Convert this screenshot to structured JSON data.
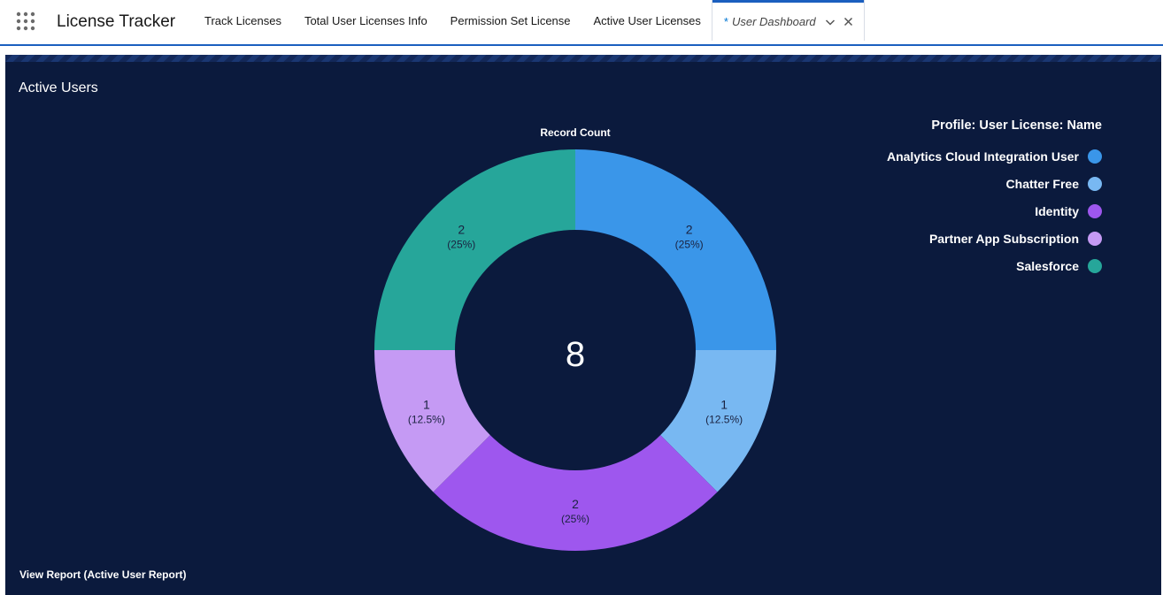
{
  "nav": {
    "app_launcher_icon": "app-launcher-grid-icon",
    "app_name": "License Tracker",
    "items": [
      {
        "label": "Track Licenses"
      },
      {
        "label": "Total User Licenses Info"
      },
      {
        "label": "Permission Set License"
      },
      {
        "label": "Active User Licenses"
      },
      {
        "label": "User Dashboard",
        "unsaved_marker": "*",
        "active": true
      }
    ]
  },
  "dashboard": {
    "widget_title": "Active Users",
    "view_report_label": "View Report (Active User Report)"
  },
  "chart_data": {
    "type": "donut",
    "title": "Record Count",
    "center_total": "8",
    "legend_title": "Profile: User License: Name",
    "legend_placement": "top-right",
    "series": [
      {
        "name": "Analytics Cloud Integration User",
        "value": 2,
        "percent_label": "(25%)",
        "color": "#3a96e9"
      },
      {
        "name": "Chatter Free",
        "value": 1,
        "percent_label": "(12.5%)",
        "color": "#78b8f2"
      },
      {
        "name": "Identity",
        "value": 2,
        "percent_label": "(25%)",
        "color": "#9e57ee"
      },
      {
        "name": "Partner App Subscription",
        "value": 1,
        "percent_label": "(12.5%)",
        "color": "#c59af4"
      },
      {
        "name": "Salesforce",
        "value": 2,
        "percent_label": "(25%)",
        "color": "#26a69a"
      }
    ]
  }
}
